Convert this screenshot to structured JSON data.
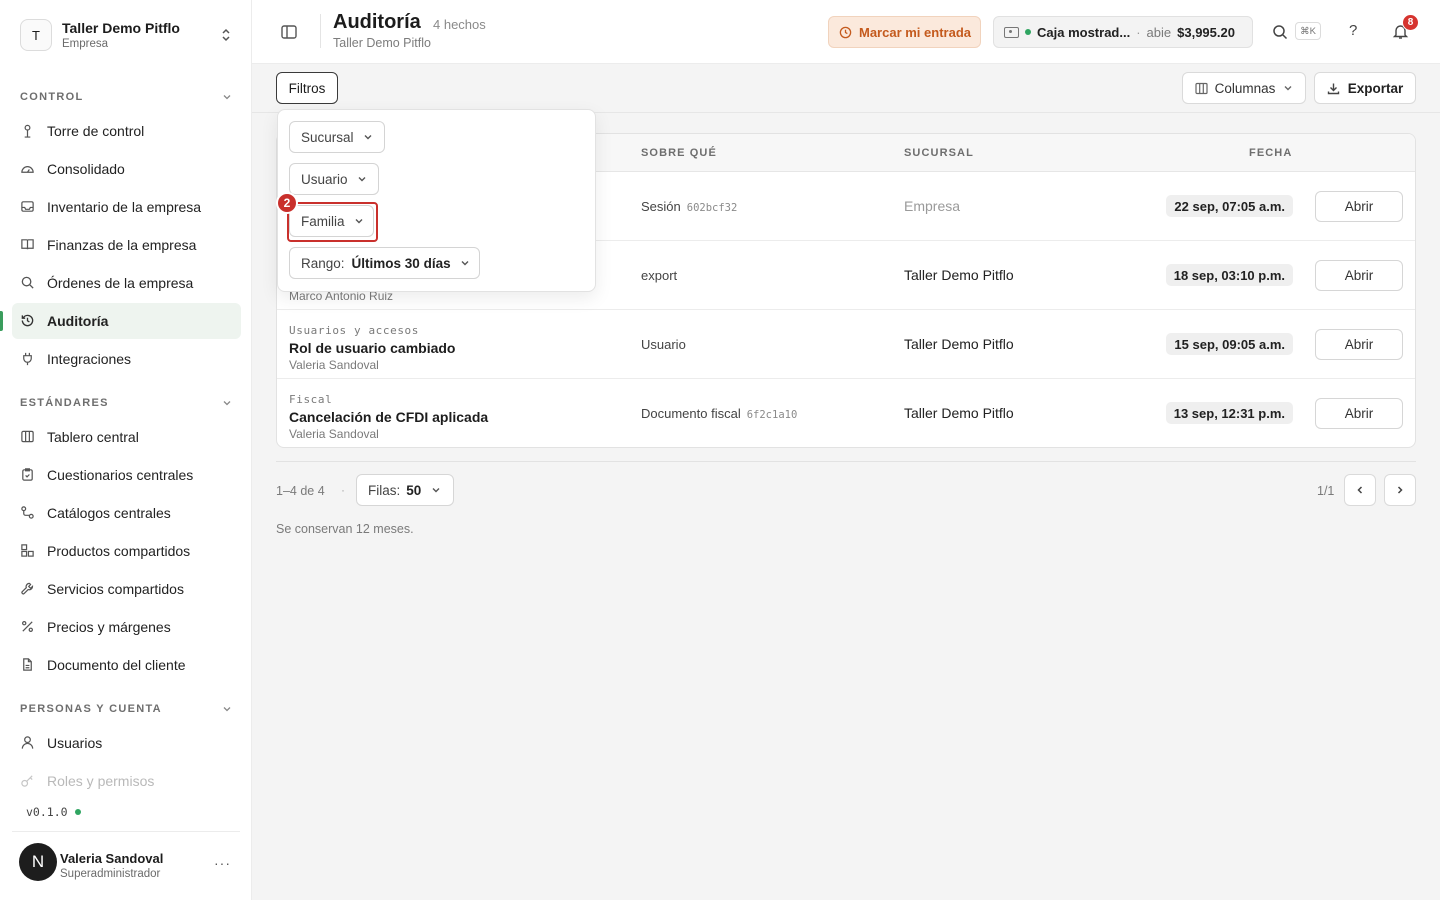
{
  "org": {
    "initial": "T",
    "name": "Taller Demo Pitflo",
    "subtitle": "Empresa"
  },
  "sidebar": {
    "sections": [
      {
        "title": "CONTROL",
        "items": [
          {
            "label": "Torre de control",
            "icon": "tower-icon"
          },
          {
            "label": "Consolidado",
            "icon": "gauge-icon"
          },
          {
            "label": "Inventario de la empresa",
            "icon": "inbox-icon"
          },
          {
            "label": "Finanzas de la empresa",
            "icon": "book-icon"
          },
          {
            "label": "Órdenes de la empresa",
            "icon": "search-icon"
          },
          {
            "label": "Auditoría",
            "icon": "history-icon",
            "active": true
          },
          {
            "label": "Integraciones",
            "icon": "plug-icon"
          }
        ]
      },
      {
        "title": "ESTÁNDARES",
        "items": [
          {
            "label": "Tablero central",
            "icon": "columns-icon"
          },
          {
            "label": "Cuestionarios centrales",
            "icon": "clipboard-icon"
          },
          {
            "label": "Catálogos centrales",
            "icon": "route-icon"
          },
          {
            "label": "Productos compartidos",
            "icon": "boxes-icon"
          },
          {
            "label": "Servicios compartidos",
            "icon": "wrench-icon"
          },
          {
            "label": "Precios y márgenes",
            "icon": "percent-icon"
          },
          {
            "label": "Documento del cliente",
            "icon": "document-icon"
          }
        ]
      },
      {
        "title": "PERSONAS Y CUENTA",
        "items": [
          {
            "label": "Usuarios",
            "icon": "user-icon"
          },
          {
            "label": "Roles y permisos",
            "icon": "key-icon",
            "faded": true
          }
        ]
      }
    ],
    "version": "v0.1.0"
  },
  "user": {
    "initial": "N",
    "name": "Valeria Sandoval",
    "role": "Superadministrador",
    "more": "···"
  },
  "header": {
    "title": "Auditoría",
    "count": "4 hechos",
    "subtitle": "Taller Demo Pitflo",
    "clock_in_label": "Marcar mi entrada",
    "register": {
      "name": "Caja mostrad...",
      "separator": "·",
      "state": "abie",
      "amount": "$3,995.20"
    },
    "shortcut": "⌘K",
    "help": "?",
    "notifications": "8"
  },
  "toolbar": {
    "filters_label": "Filtros",
    "columns_label": "Columnas",
    "export_label": "Exportar"
  },
  "filter_popover": {
    "branch_label": "Sucursal",
    "user_label": "Usuario",
    "family_label": "Familia",
    "range_label": "Rango:",
    "range_value": "Últimos 30 días",
    "highlight_number": "2"
  },
  "table": {
    "headers": {
      "about": "SOBRE QUÉ",
      "branch": "SUCURSAL",
      "date": "FECHA"
    },
    "rows": [
      {
        "category": "",
        "event": "",
        "actor": "",
        "about": "Sesión",
        "about_code": "602bcf32",
        "branch": "Empresa",
        "branch_muted": true,
        "date": "22 sep, 07:05 a.m.",
        "action": "Abrir"
      },
      {
        "category": "",
        "event": "",
        "actor": "Marco Antonio Ruiz",
        "about": "export",
        "about_code": "",
        "branch": "Taller Demo Pitflo",
        "date": "18 sep, 03:10 p.m.",
        "action": "Abrir"
      },
      {
        "category": "Usuarios y accesos",
        "event": "Rol de usuario cambiado",
        "actor": "Valeria Sandoval",
        "about": "Usuario",
        "about_code": "",
        "branch": "Taller Demo Pitflo",
        "date": "15 sep, 09:05 a.m.",
        "action": "Abrir"
      },
      {
        "category": "Fiscal",
        "event": "Cancelación de CFDI aplicada",
        "actor": "Valeria Sandoval",
        "about": "Documento fiscal",
        "about_code": "6f2c1a10",
        "branch": "Taller Demo Pitflo",
        "date": "13 sep, 12:31 p.m.",
        "action": "Abrir"
      }
    ]
  },
  "pagination": {
    "range": "1–4 de 4",
    "dot": "·",
    "rows_label": "Filas:",
    "rows_value": "50",
    "page": "1/1"
  },
  "retention_note": "Se conservan 12 meses.",
  "colors": {
    "accent_green": "#3a9d5d",
    "clock_in_orange": "#c45a1d",
    "highlight_red": "#c9302c",
    "badge_red": "#d6342f"
  }
}
